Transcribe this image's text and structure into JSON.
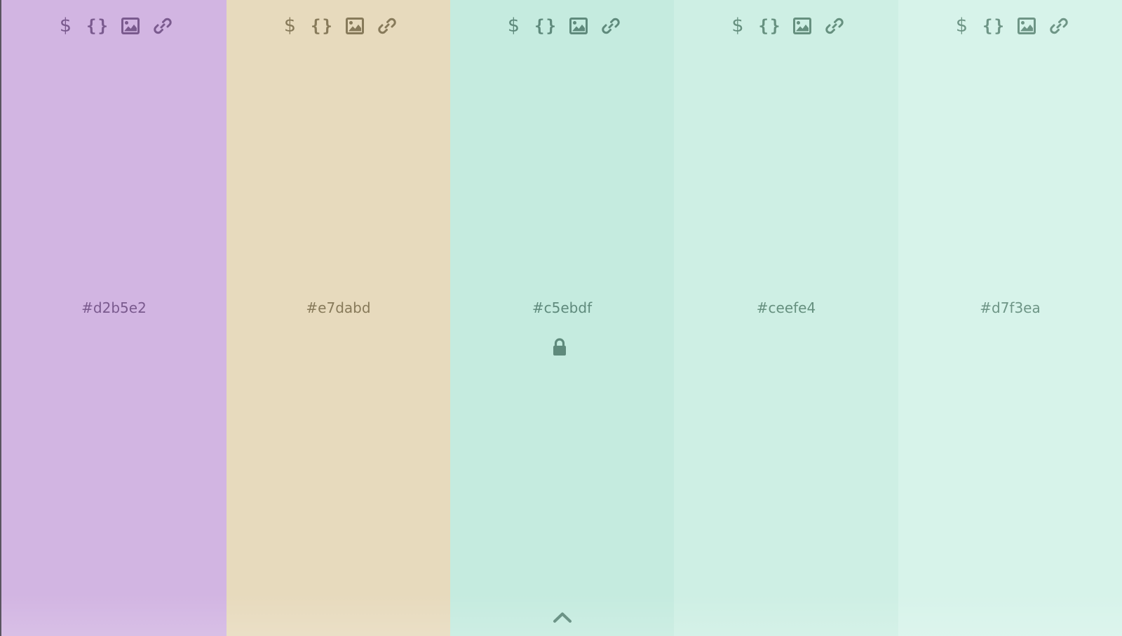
{
  "palette": {
    "swatches": [
      {
        "hex": "#d2b5e2",
        "bg": "#d2b5e2",
        "fg": "#7a5a8e",
        "locked": false
      },
      {
        "hex": "#e7dabd",
        "bg": "#e7dabd",
        "fg": "#877a5a",
        "locked": false
      },
      {
        "hex": "#c5ebdf",
        "bg": "#c5ebdf",
        "fg": "#5f8a7c",
        "locked": true
      },
      {
        "hex": "#ceefe4",
        "bg": "#ceefe4",
        "fg": "#66907f",
        "locked": false
      },
      {
        "hex": "#d7f3ea",
        "bg": "#d7f3ea",
        "fg": "#6e9586",
        "locked": false
      }
    ]
  },
  "toolbar": {
    "dollar_glyph": "$",
    "braces_glyph": "{}",
    "icons": [
      "dollar-icon",
      "braces-icon",
      "image-icon",
      "link-icon"
    ]
  },
  "controls": {
    "lock_icon": "lock-icon",
    "expand_icon": "chevron-up-icon"
  }
}
